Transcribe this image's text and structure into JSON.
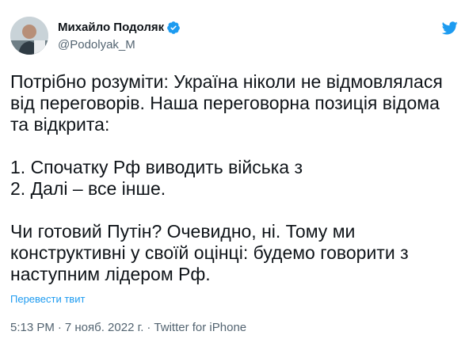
{
  "author": {
    "display_name": "Михайло Подоляк",
    "handle": "@Podolyak_M"
  },
  "icons": {
    "verified": "verified-badge-icon",
    "more": "more-options-icon",
    "flag": "ukraine-flag-emoji"
  },
  "tweet": {
    "line1": "Потрібно розуміти: Україна ніколи не відмовлялася",
    "line2": "від переговорів. Наша переговорна позиція відома",
    "line3": "та відкрита:",
    "point1": "1. Спочатку Рф виводить війська з",
    "point2": "2. Далі – все інше.",
    "line4": "Чи готовий Путін? Очевидно, ні. Тому ми",
    "line5": "конструктивні у своїй оцінці: будемо говорити з",
    "line6": "наступним лідером Рф."
  },
  "translate_label": "Перевести твит",
  "meta": {
    "time": "5:13 PM",
    "separator": "·",
    "date": "7 нояб. 2022 г.",
    "source": "Twitter for iPhone"
  },
  "colors": {
    "text": "#0f1419",
    "secondary": "#536471",
    "link": "#1d9bf0",
    "flag_blue": "#2f6fc4",
    "flag_yellow": "#f7cd2a"
  }
}
